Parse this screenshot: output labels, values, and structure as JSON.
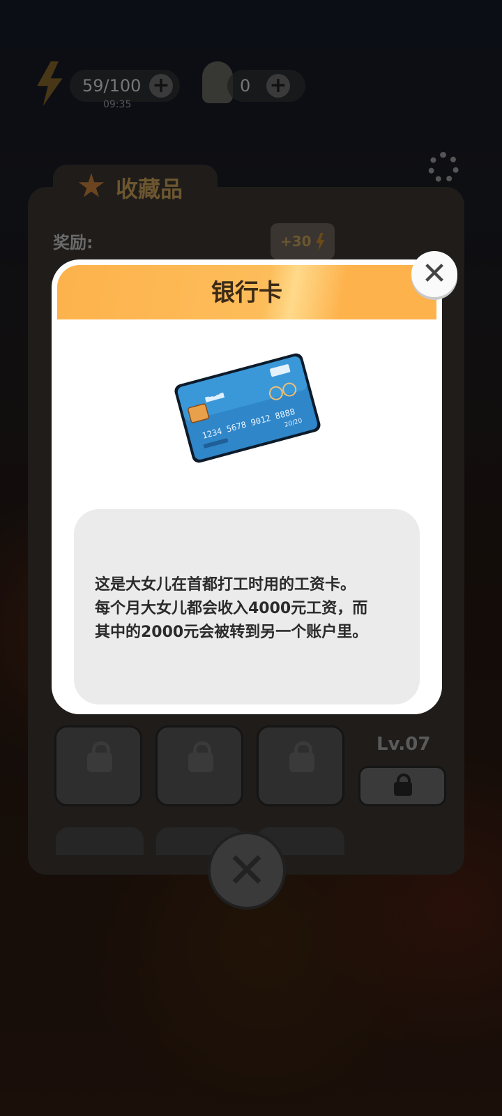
{
  "hud": {
    "energy": "59/100",
    "energy_timer": "09:35",
    "hint_count": "0",
    "plus_symbol": "+"
  },
  "collection_panel": {
    "title": "收藏品",
    "reward_label": "奖励:",
    "reward_value": "+30",
    "locked_level": "Lv.07",
    "close_symbol": "✕"
  },
  "item_modal": {
    "title": "银行卡",
    "description_lines": [
      "这是大女儿在首都打工时用的工资卡。",
      "每个月大女儿都会收入4000元工资，而",
      "其中的2000元会被转到另一个账户里。"
    ],
    "close_symbol": "✕",
    "card": {
      "number": "1234  5678  9012  8888",
      "expiry": "20/20"
    }
  }
}
